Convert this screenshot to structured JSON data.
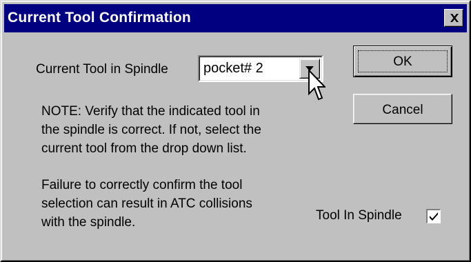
{
  "window": {
    "title": "Current Tool Confirmation",
    "close_icon": "close-x-icon"
  },
  "form": {
    "tool_label": "Current Tool in Spindle",
    "tool_select": {
      "value": "pocket# 2",
      "dropdown_icon": "chevron-down-icon"
    }
  },
  "buttons": {
    "ok_label": "OK",
    "cancel_label": "Cancel"
  },
  "note": {
    "paragraph1": [
      "NOTE: Verify that the indicated tool in",
      "the spindle is correct. If not, select the",
      "current tool from the drop down list."
    ],
    "paragraph2": [
      "Failure to correctly confirm the tool",
      "selection can result in ATC collisions",
      "with the spindle."
    ]
  },
  "tool_in_spindle": {
    "label": "Tool In Spindle",
    "checked": true
  },
  "colors": {
    "titlebar": "#000080",
    "face": "#c0c0c0"
  }
}
